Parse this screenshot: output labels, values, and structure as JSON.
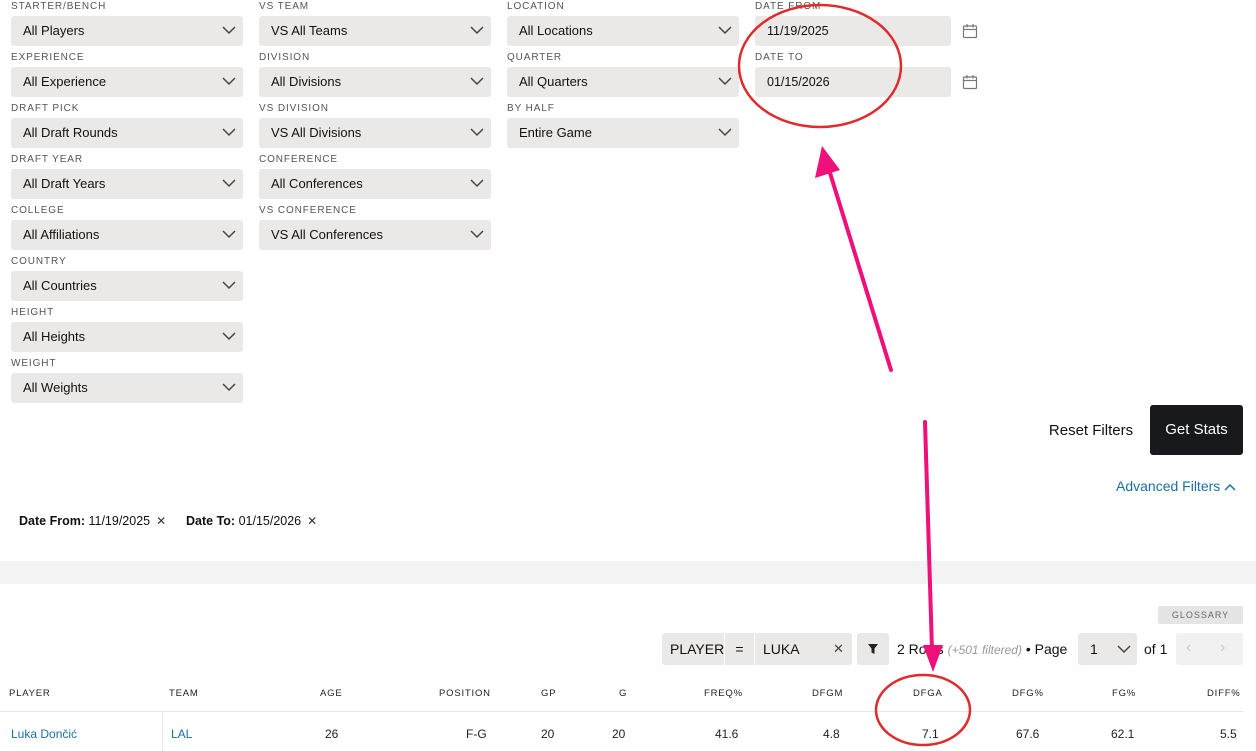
{
  "filters": {
    "col1": [
      {
        "label": "STARTER/BENCH",
        "value": "All Players"
      },
      {
        "label": "EXPERIENCE",
        "value": "All Experience"
      },
      {
        "label": "DRAFT PICK",
        "value": "All Draft Rounds"
      },
      {
        "label": "DRAFT YEAR",
        "value": "All Draft Years"
      },
      {
        "label": "COLLEGE",
        "value": "All Affiliations"
      },
      {
        "label": "COUNTRY",
        "value": "All Countries"
      },
      {
        "label": "HEIGHT",
        "value": "All Heights"
      },
      {
        "label": "WEIGHT",
        "value": "All Weights"
      }
    ],
    "col2": [
      {
        "label": "VS TEAM",
        "value": "VS All Teams"
      },
      {
        "label": "DIVISION",
        "value": "All Divisions"
      },
      {
        "label": "VS DIVISION",
        "value": "VS All Divisions"
      },
      {
        "label": "CONFERENCE",
        "value": "All Conferences"
      },
      {
        "label": "VS CONFERENCE",
        "value": "VS All Conferences"
      }
    ],
    "col3": [
      {
        "label": "LOCATION",
        "value": "All Locations"
      },
      {
        "label": "QUARTER",
        "value": "All Quarters"
      },
      {
        "label": "BY HALF",
        "value": "Entire Game"
      }
    ],
    "date_from": {
      "label": "DATE FROM",
      "value": "11/19/2025"
    },
    "date_to": {
      "label": "DATE TO",
      "value": "01/15/2026"
    }
  },
  "actions": {
    "reset": "Reset Filters",
    "get_stats": "Get Stats",
    "advanced": "Advanced Filters"
  },
  "active_filters": [
    {
      "key": "Date From:",
      "value": "11/19/2025"
    },
    {
      "key": "Date To:",
      "value": "01/15/2026"
    }
  ],
  "table_toolbar": {
    "glossary": "GLOSSARY",
    "field": "PLAYER",
    "operator": "=",
    "search_value": "LUKA",
    "rows": "2 Rows",
    "filtered": "(+501 filtered)",
    "page_label": "• Page",
    "page": "1",
    "of": "of 1"
  },
  "table": {
    "columns": [
      "PLAYER",
      "TEAM",
      "AGE",
      "POSITION",
      "GP",
      "G",
      "FREQ%",
      "DFGM",
      "DFGA",
      "DFG%",
      "FG%",
      "DIFF%"
    ],
    "rows": [
      [
        "Luka Dončić",
        "LAL",
        "26",
        "F-G",
        "20",
        "20",
        "41.6",
        "4.8",
        "7.1",
        "67.6",
        "62.1",
        "5.5"
      ]
    ]
  },
  "annotation_colors": {
    "circle": "#e02b2b",
    "arrow": "#f0107a"
  }
}
